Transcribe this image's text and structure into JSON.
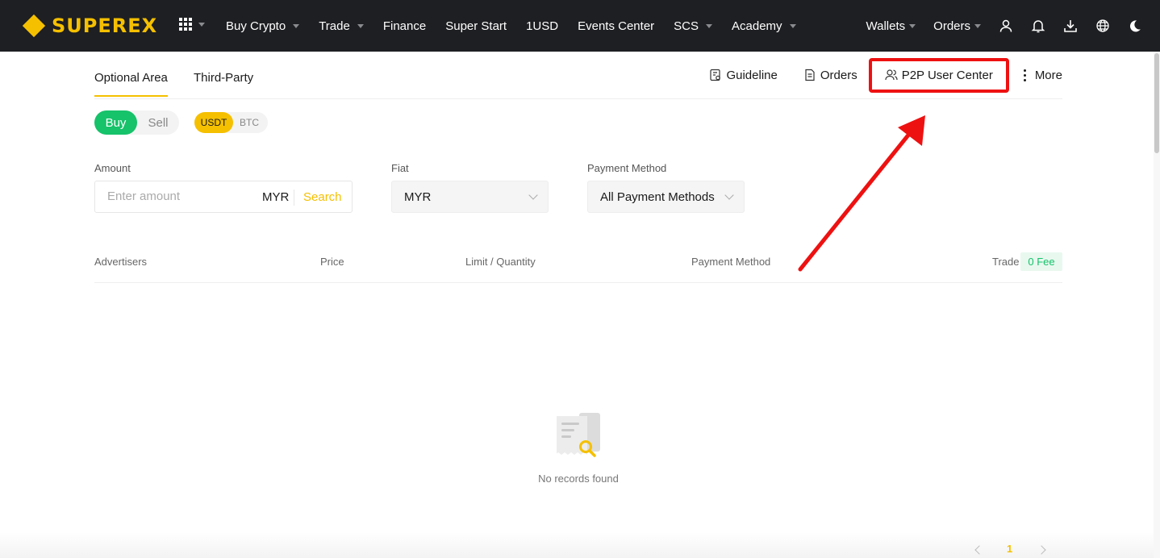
{
  "app": {
    "logo_text": "SUPEREX",
    "brand_color": "#f5c000",
    "accent_green": "#16c26a",
    "highlight_red": "#ee1111"
  },
  "topnav": {
    "apps_icon": "grid-icon",
    "items": [
      {
        "label": "Buy Crypto",
        "has_dropdown": true
      },
      {
        "label": "Trade",
        "has_dropdown": true
      },
      {
        "label": "Finance",
        "has_dropdown": false
      },
      {
        "label": "Super Start",
        "has_dropdown": false
      },
      {
        "label": "1USD",
        "has_dropdown": false
      },
      {
        "label": "Events Center",
        "has_dropdown": false
      },
      {
        "label": "SCS",
        "has_dropdown": true
      },
      {
        "label": "Academy",
        "has_dropdown": true
      }
    ],
    "right": {
      "wallets_label": "Wallets",
      "orders_label": "Orders",
      "icons": [
        "user-icon",
        "bell-icon",
        "download-icon",
        "globe-icon",
        "moon-icon"
      ]
    }
  },
  "subheader": {
    "tabs": [
      {
        "label": "Optional Area",
        "active": true
      },
      {
        "label": "Third-Party",
        "active": false
      }
    ],
    "links": {
      "guideline": "Guideline",
      "orders": "Orders",
      "p2p_user_center": "P2P User Center",
      "more": "More"
    }
  },
  "trade_side": {
    "buy": "Buy",
    "sell": "Sell",
    "selected": "Buy"
  },
  "coins": {
    "options": [
      "USDT",
      "BTC"
    ],
    "selected": "USDT"
  },
  "filters": {
    "amount": {
      "label": "Amount",
      "placeholder": "Enter amount",
      "currency": "MYR",
      "search": "Search",
      "value": ""
    },
    "fiat": {
      "label": "Fiat",
      "value": "MYR"
    },
    "payment": {
      "label": "Payment Method",
      "value": "All Payment Methods"
    }
  },
  "table": {
    "columns": [
      "Advertisers",
      "Price",
      "Limit / Quantity",
      "Payment Method",
      "Trade"
    ],
    "fee_badge": "0 Fee",
    "rows": [],
    "empty_text": "No records found"
  },
  "pagination": {
    "current_page": "1"
  }
}
